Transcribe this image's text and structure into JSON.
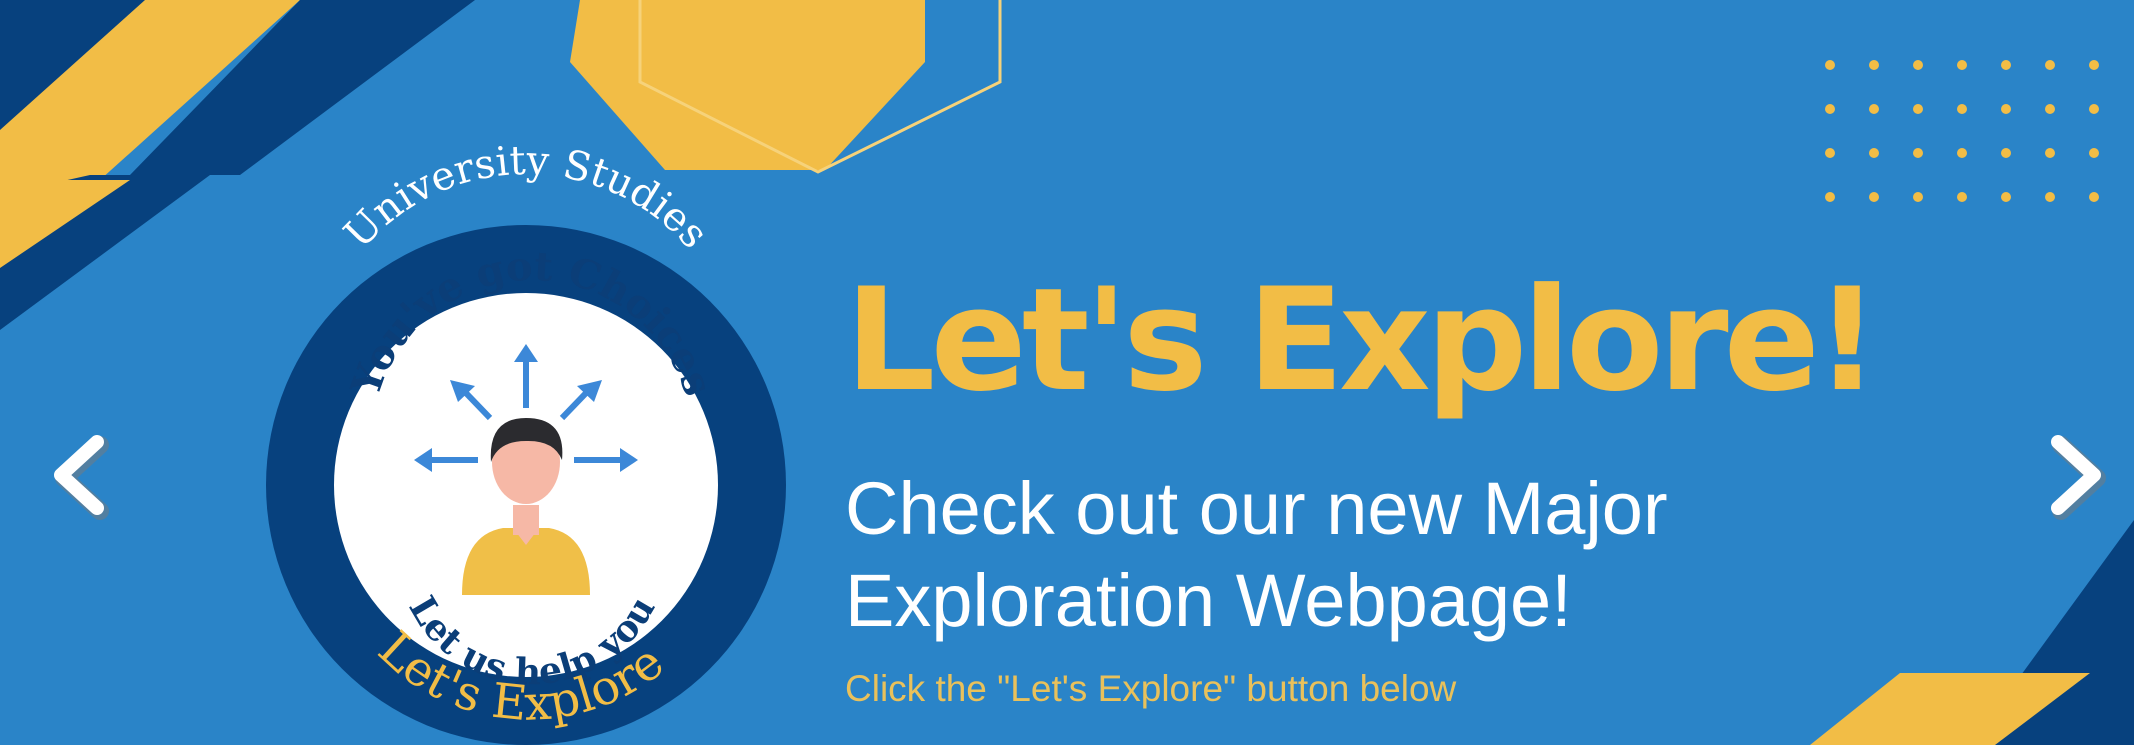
{
  "slide": {
    "headline": "Let's Explore!",
    "subhead_lines": [
      "Check out our new Major",
      "Exploration Webpage!"
    ],
    "caption": "Click the \"Let's Explore\" button below"
  },
  "logo": {
    "top_arc": "University Studies",
    "choices_arc": "You've got Choices",
    "help_arc": "Let us help you",
    "bottom_arc": "Let's Explore"
  },
  "nav": {
    "prev_icon": "chevron-left-icon",
    "next_icon": "chevron-right-icon"
  },
  "colors": {
    "background": "#2a84c8",
    "navy": "#07417e",
    "gold": "#f2bd46",
    "white": "#ffffff",
    "logo_text": "#0b3e78",
    "arrow_blue": "#3c88d8",
    "skin": "#f6b8a6",
    "hair": "#2b2b2f",
    "shirt": "#f0bf48",
    "caption": "#e9c15b"
  }
}
